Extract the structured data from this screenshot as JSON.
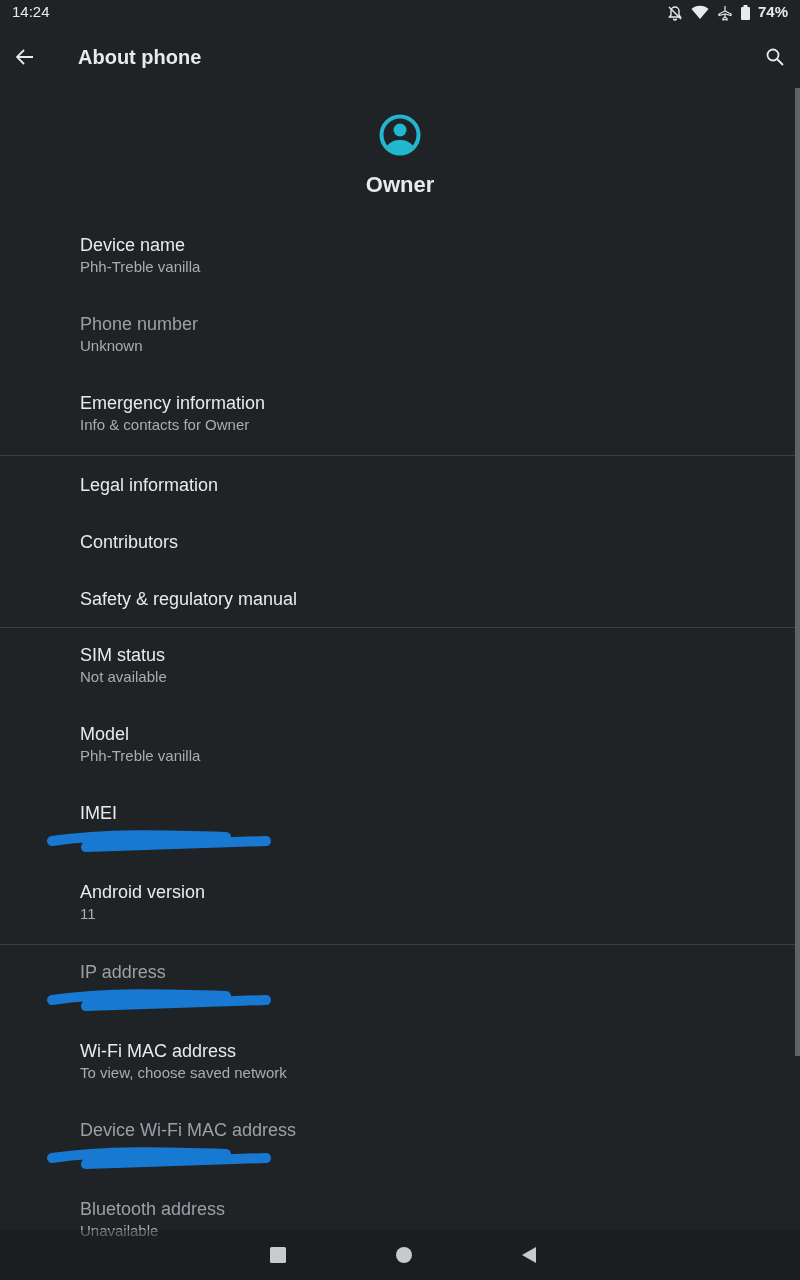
{
  "status_bar": {
    "time": "14:24",
    "battery": "74%"
  },
  "app_bar": {
    "title": "About phone"
  },
  "profile": {
    "name": "Owner"
  },
  "groups": [
    {
      "items": [
        {
          "title": "Device name",
          "summary": "Phh-Treble vanilla",
          "disabled": false
        },
        {
          "title": "Phone number",
          "summary": "Unknown",
          "disabled": true
        },
        {
          "title": "Emergency information",
          "summary": "Info & contacts for Owner",
          "disabled": false
        }
      ]
    },
    {
      "items": [
        {
          "title": "Legal information",
          "disabled": false
        },
        {
          "title": "Contributors",
          "disabled": false
        },
        {
          "title": "Safety & regulatory manual",
          "disabled": false
        }
      ]
    },
    {
      "items": [
        {
          "title": "SIM status",
          "summary": "Not available",
          "disabled": false
        },
        {
          "title": "Model",
          "summary": "Phh-Treble vanilla",
          "disabled": false
        },
        {
          "title": "IMEI",
          "redacted": true,
          "disabled": false
        },
        {
          "title": "Android version",
          "summary": "11",
          "disabled": false
        }
      ]
    },
    {
      "items": [
        {
          "title": "IP address",
          "redacted": true,
          "disabled": true
        },
        {
          "title": "Wi-Fi MAC address",
          "summary": "To view, choose saved network",
          "disabled": false
        },
        {
          "title": "Device Wi-Fi MAC address",
          "redacted": true,
          "disabled": true
        },
        {
          "title": "Bluetooth address",
          "summary": "Unavailable",
          "disabled": true
        }
      ]
    }
  ]
}
